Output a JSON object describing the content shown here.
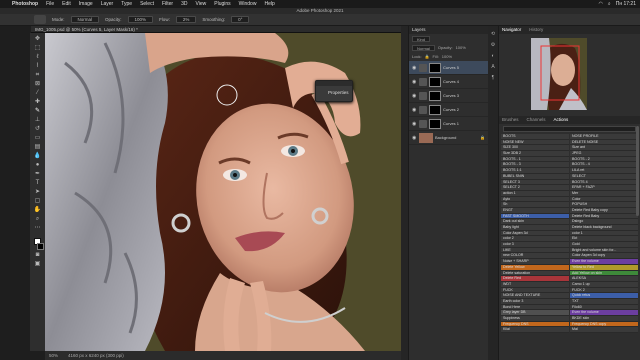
{
  "mac": {
    "app_name": "Photoshop",
    "menu": [
      "File",
      "Edit",
      "Image",
      "Layer",
      "Type",
      "Select",
      "Filter",
      "3D",
      "View",
      "Plugins",
      "Window",
      "Help"
    ],
    "clock": "Пн 17:21"
  },
  "ps_title": "Adobe Photoshop 2021",
  "options": {
    "mode_label": "Mode:",
    "mode_value": "Normal",
    "opacity_label": "Opacity:",
    "opacity_value": "100%",
    "flow_label": "Flow:",
    "flow_value": "2%",
    "smoothing_label": "Smoothing:",
    "angle_value": "0°"
  },
  "document_tab": "IMG_1005.psd @ 50% (Curves 5, Layer Mask/16) *",
  "status": {
    "zoom": "50%",
    "info": "4160 px x 6240 px (300 ppi)"
  },
  "properties_popup": {
    "label": "Properties"
  },
  "layers": {
    "tab": "Layers",
    "kind": "Kind",
    "blend": "Normal",
    "opacity_label": "Opacity:",
    "opacity_value": "100%",
    "lock_label": "Lock:",
    "fill_label": "Fill:",
    "fill_value": "100%",
    "rows": [
      {
        "name": "Curves 5",
        "selected": true
      },
      {
        "name": "Curves 4",
        "selected": false
      },
      {
        "name": "Curves 3",
        "selected": false
      },
      {
        "name": "Curves 2",
        "selected": false
      },
      {
        "name": "Curves 1",
        "selected": false
      },
      {
        "name": "Background",
        "selected": false
      }
    ]
  },
  "navigator": {
    "tab_active": "Navigator",
    "tab_other": "History"
  },
  "actions_panel": {
    "tabs": [
      "Brushes",
      "Channels",
      "Actions"
    ],
    "active_tab": "Actions",
    "items": [
      {
        "label": "BOOTS",
        "color": "none"
      },
      {
        "label": "NOSE PROFILE",
        "color": "none"
      },
      {
        "label": "NOISE NEW",
        "color": "none"
      },
      {
        "label": "DELETE NOISE",
        "color": "none"
      },
      {
        "label": "SIZE 300",
        "color": "none"
      },
      {
        "label": "Size ant",
        "color": "none"
      },
      {
        "label": "Size 3DB 2",
        "color": "none"
      },
      {
        "label": "JPEG",
        "color": "none"
      },
      {
        "label": "BOOTS - 1",
        "color": "none"
      },
      {
        "label": "BOOTS - 2",
        "color": "none"
      },
      {
        "label": "BOOTS - 3",
        "color": "none"
      },
      {
        "label": "BOOTS - 4",
        "color": "none"
      },
      {
        "label": "BOOTS 1:1",
        "color": "none"
      },
      {
        "label": "LILA ret",
        "color": "none"
      },
      {
        "label": "BUBEL SNIN",
        "color": "none"
      },
      {
        "label": "SELECT",
        "color": "none"
      },
      {
        "label": "SELECT 3",
        "color": "none"
      },
      {
        "label": "BOOTS 4",
        "color": "none"
      },
      {
        "label": "SELECT 2",
        "color": "none"
      },
      {
        "label": "EPAR + FAZP",
        "color": "none"
      },
      {
        "label": "action 1",
        "color": "none"
      },
      {
        "label": "Mer",
        "color": "none"
      },
      {
        "label": "Ayto",
        "color": "none"
      },
      {
        "label": "Color",
        "color": "none"
      },
      {
        "label": "Sh",
        "color": "none"
      },
      {
        "label": "POPUSH",
        "color": "none"
      },
      {
        "label": "ENGT",
        "color": "none"
      },
      {
        "label": "Delete Red Baby copy",
        "color": "none"
      },
      {
        "label": "FAST SMOOTH",
        "color": "blue"
      },
      {
        "label": "Delete Red Baby",
        "color": "none"
      },
      {
        "label": "Dark out skin",
        "color": "none"
      },
      {
        "label": "Dsingo",
        "color": "none"
      },
      {
        "label": "Baby light",
        "color": "none"
      },
      {
        "label": "Delete black background",
        "color": "none"
      },
      {
        "label": "Color Aspen 3d",
        "color": "none"
      },
      {
        "label": "color 1",
        "color": "none"
      },
      {
        "label": "color 2",
        "color": "none"
      },
      {
        "label": "Ekt",
        "color": "none"
      },
      {
        "label": "color 3",
        "color": "none"
      },
      {
        "label": "Gold",
        "color": "none"
      },
      {
        "label": "LIKE",
        "color": "none"
      },
      {
        "label": "Bright and volume skin for...",
        "color": "none"
      },
      {
        "label": "new COLOR",
        "color": "none"
      },
      {
        "label": "Color Aspen 3d copy",
        "color": "none"
      },
      {
        "label": "Noise + SHARP",
        "color": "none"
      },
      {
        "label": "Even the volume",
        "color": "violet"
      },
      {
        "label": "Delete Yellow",
        "color": "orange"
      },
      {
        "label": "Yellow to Red",
        "color": "yellow"
      },
      {
        "label": "Delete saturation",
        "color": "none"
      },
      {
        "label": "Add Yellow on skin",
        "color": "green"
      },
      {
        "label": "Delete Red",
        "color": "red"
      },
      {
        "label": "ALEKSA",
        "color": "none"
      },
      {
        "label": "WDT",
        "color": "none"
      },
      {
        "label": "Camo 1 up",
        "color": "none"
      },
      {
        "label": "FUCK",
        "color": "none"
      },
      {
        "label": "FUCK 2",
        "color": "none"
      },
      {
        "label": "NOISE AND TEXTURE",
        "color": "none"
      },
      {
        "label": "Quick retus",
        "color": "blue"
      },
      {
        "label": "Earth color 3",
        "color": "none"
      },
      {
        "label": "TXT",
        "color": "none"
      },
      {
        "label": "Bond Here",
        "color": "none"
      },
      {
        "label": "Filo60",
        "color": "none"
      },
      {
        "label": "Grey layer DB",
        "color": "gray"
      },
      {
        "label": "Even the volume",
        "color": "violet"
      },
      {
        "label": "Suppiness",
        "color": "none"
      },
      {
        "label": "BKDE skin",
        "color": "none"
      },
      {
        "label": "Frequency DNS",
        "color": "orange"
      },
      {
        "label": "Frequency DNS copy",
        "color": "orange"
      },
      {
        "label": "Kiiai",
        "color": "none"
      },
      {
        "label": "Mal",
        "color": "none"
      }
    ]
  }
}
